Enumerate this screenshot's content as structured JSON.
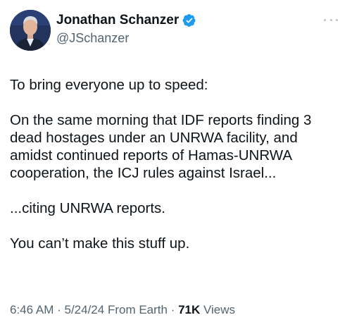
{
  "author": {
    "display_name": "Jonathan Schanzer",
    "handle": "@JSchanzer",
    "verified_icon": "verified-badge-icon",
    "avatar_icon": "profile-photo"
  },
  "tweet": {
    "paragraphs": [
      "To bring everyone up to speed:",
      "On the same morning that IDF reports finding 3\ndead hostages under an UNRWA facility, and\namidst continued reports of Hamas-UNRWA\ncooperation, the ICJ rules against Israel...",
      "...citing UNRWA reports.",
      "You can’t make this stuff up."
    ]
  },
  "meta": {
    "time": "6:46 AM",
    "separator1": " · ",
    "date": "5/24/24",
    "source": " From Earth",
    "separator2": " · ",
    "views_count": "71K",
    "views_label": " Views"
  },
  "colors": {
    "text_primary": "#0f1419",
    "text_secondary": "#536471",
    "verified": "#1d9bf0"
  }
}
